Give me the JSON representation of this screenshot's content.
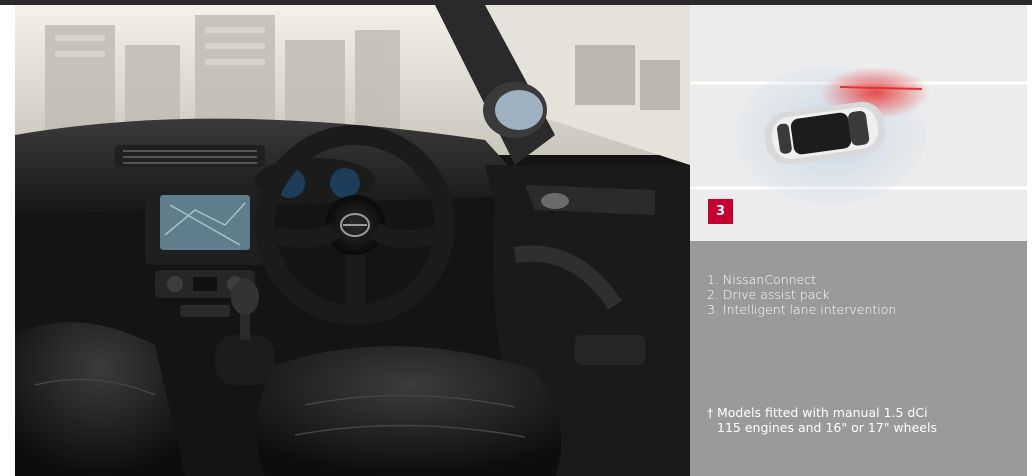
{
  "lane_badge": {
    "number": "3"
  },
  "features": {
    "items": [
      "1.  NissanConnect",
      "2.  Drive assist pack",
      "3.  Intelligent lane intervention"
    ]
  },
  "footnote": {
    "mark": "†",
    "line1": "Models fitted with manual 1.5 dCi",
    "line2": "115 engines and 16\" or 17\" wheels"
  },
  "colors": {
    "badge": "#c3002f",
    "caption_panel": "#9a9a99",
    "lane_warning": "#e8302f"
  }
}
